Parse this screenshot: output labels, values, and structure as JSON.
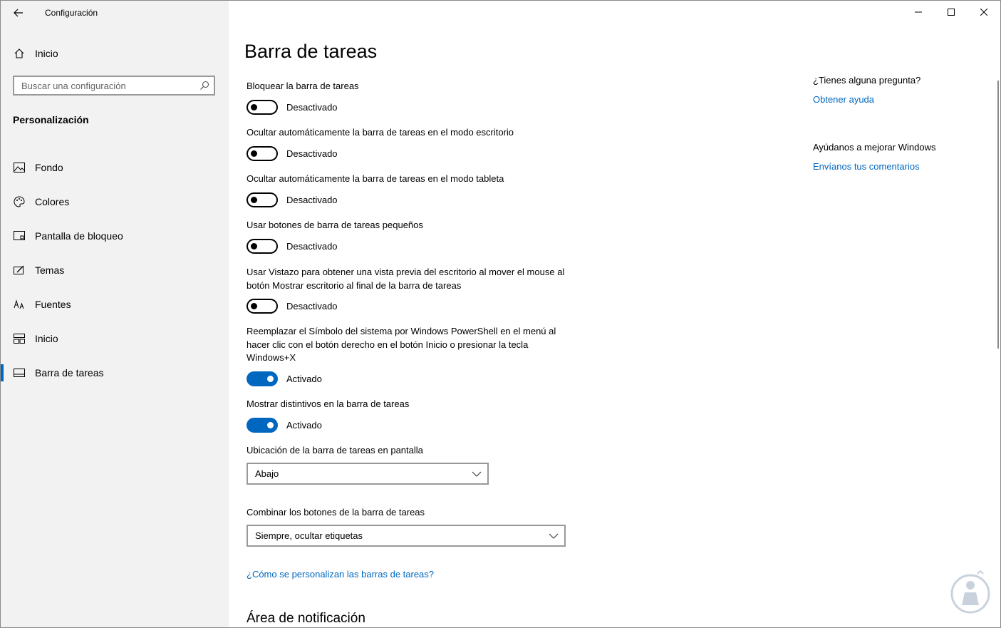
{
  "window": {
    "title": "Configuración"
  },
  "sidebar": {
    "home_label": "Inicio",
    "search_placeholder": "Buscar una configuración",
    "section_title": "Personalización",
    "items": [
      {
        "label": "Fondo",
        "icon": "image-icon",
        "selected": false
      },
      {
        "label": "Colores",
        "icon": "palette-icon",
        "selected": false
      },
      {
        "label": "Pantalla de bloqueo",
        "icon": "lock-screen-icon",
        "selected": false
      },
      {
        "label": "Temas",
        "icon": "brush-icon",
        "selected": false
      },
      {
        "label": "Fuentes",
        "icon": "font-icon",
        "selected": false
      },
      {
        "label": "Inicio",
        "icon": "start-tiles-icon",
        "selected": false
      },
      {
        "label": "Barra de tareas",
        "icon": "taskbar-icon",
        "selected": true
      }
    ]
  },
  "main": {
    "title": "Barra de tareas",
    "settings": [
      {
        "label": "Bloquear la barra de tareas",
        "state": "Desactivado",
        "on": false
      },
      {
        "label": "Ocultar automáticamente la barra de tareas en el modo escritorio",
        "state": "Desactivado",
        "on": false
      },
      {
        "label": "Ocultar automáticamente la barra de tareas en el modo tableta",
        "state": "Desactivado",
        "on": false
      },
      {
        "label": "Usar botones de barra de tareas pequeños",
        "state": "Desactivado",
        "on": false
      },
      {
        "label": "Usar Vistazo para obtener una vista previa del escritorio al mover el mouse al botón Mostrar escritorio al final de la barra de tareas",
        "state": "Desactivado",
        "on": false
      },
      {
        "label": "Reemplazar el Símbolo del sistema por Windows PowerShell en el menú al hacer clic con el botón derecho en el botón Inicio o presionar la tecla Windows+X",
        "state": "Activado",
        "on": true
      },
      {
        "label": "Mostrar distintivos en la barra de tareas",
        "state": "Activado",
        "on": true
      }
    ],
    "location_label": "Ubicación de la barra de tareas en pantalla",
    "location_value": "Abajo",
    "combine_label": "Combinar los botones de la barra de tareas",
    "combine_value": "Siempre, ocultar etiquetas",
    "help_link": "¿Cómo se personalizan las barras de tareas?",
    "notification_title": "Área de notificación"
  },
  "aside": {
    "question": "¿Tienes alguna pregunta?",
    "help_link": "Obtener ayuda",
    "improve": "Ayúdanos a mejorar Windows",
    "feedback_link": "Envíanos tus comentarios"
  },
  "colors": {
    "accent": "#0067c0",
    "sidebar_bg": "#f2f2f2"
  }
}
